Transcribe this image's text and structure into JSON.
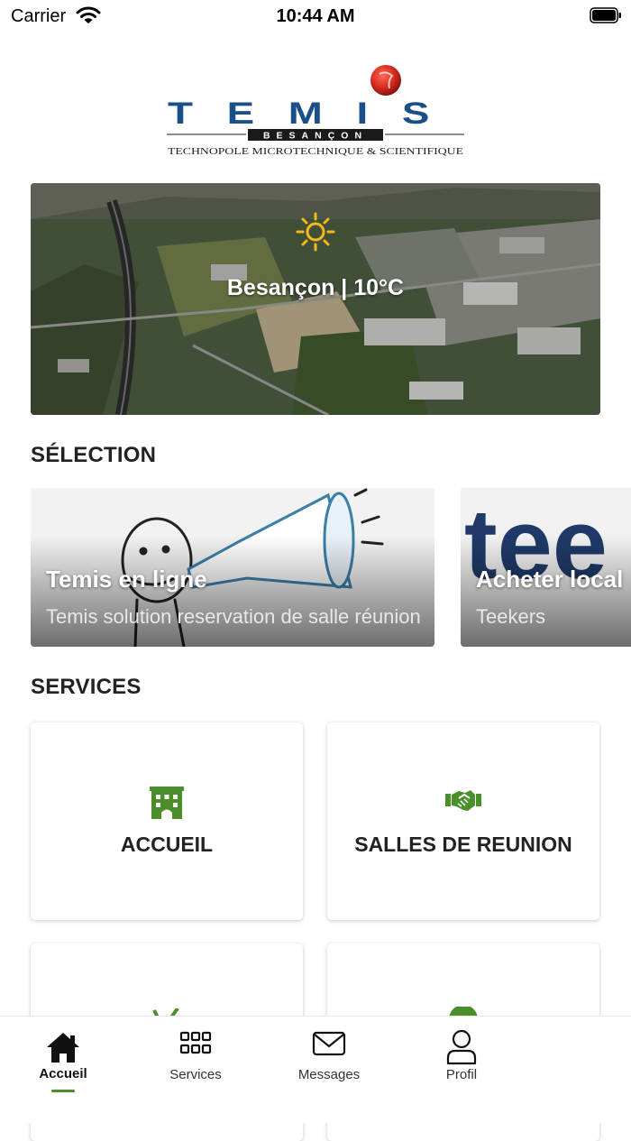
{
  "status_bar": {
    "carrier": "Carrier",
    "time": "10:44 AM"
  },
  "logo": {
    "name": "TEMIS",
    "city": "BESANÇON",
    "tagline": "TECHNOPOLE MICROTECHNIQUE & SCIENTIFIQUE"
  },
  "weather": {
    "text": "Besançon | 10°C",
    "icon": "sun-icon"
  },
  "selection": {
    "title": "SÉLECTION",
    "cards": [
      {
        "title": "Temis en ligne",
        "subtitle": "Temis solution reservation de salle réunion"
      },
      {
        "title": "Acheter local",
        "subtitle": "Teekers"
      }
    ]
  },
  "services": {
    "title": "SERVICES",
    "tiles": [
      {
        "label": "ACCUEIL",
        "icon": "building-icon"
      },
      {
        "label": "SALLES DE REUNION",
        "icon": "handshake-icon"
      },
      {
        "label": "",
        "icon": "leaf-icon"
      },
      {
        "label": "",
        "icon": "circle-icon"
      }
    ]
  },
  "tabs": [
    {
      "label": "Accueil",
      "icon": "home-icon",
      "active": true
    },
    {
      "label": "Services",
      "icon": "grid-icon",
      "active": false
    },
    {
      "label": "Messages",
      "icon": "envelope-icon",
      "active": false
    },
    {
      "label": "Profil",
      "icon": "user-icon",
      "active": false
    }
  ],
  "colors": {
    "accent": "#4a8f2a",
    "logo_blue": "#1a4f8a",
    "logo_red": "#d62a1e"
  }
}
